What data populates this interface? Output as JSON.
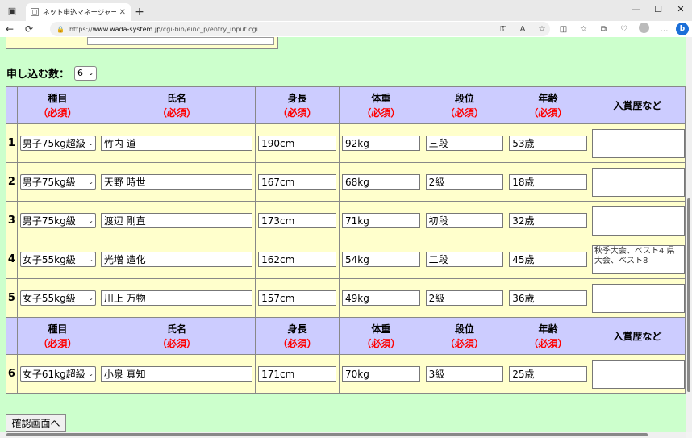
{
  "browser": {
    "tab_title": "ネット申込マネージャー 申込内容入力",
    "tab_close": "✕",
    "new_tab": "+",
    "url_prefix": "https://",
    "url_host": "www.wada-system.jp",
    "url_path": "/cgi-bin/einc_p/entry_input.cgi"
  },
  "form": {
    "count_label": "申し込む数：",
    "count_value": "6",
    "headers": [
      {
        "name": "種目",
        "req": "（必須）"
      },
      {
        "name": "氏名",
        "req": "（必須）"
      },
      {
        "name": "身長",
        "req": "（必須）"
      },
      {
        "name": "体重",
        "req": "（必須）"
      },
      {
        "name": "段位",
        "req": "（必須）"
      },
      {
        "name": "年齢",
        "req": "（必須）"
      },
      {
        "name": "入賞歴など",
        "req": ""
      }
    ],
    "rows": [
      {
        "num": "1",
        "category": "男子75kg超級",
        "name": "竹内 道",
        "height": "190cm",
        "weight": "92kg",
        "rank": "三段",
        "age": "53歳",
        "awards": ""
      },
      {
        "num": "2",
        "category": "男子75kg級",
        "name": "天野 時世",
        "height": "167cm",
        "weight": "68kg",
        "rank": "2級",
        "age": "18歳",
        "awards": ""
      },
      {
        "num": "3",
        "category": "男子75kg級",
        "name": "渡辺 剛直",
        "height": "173cm",
        "weight": "71kg",
        "rank": "初段",
        "age": "32歳",
        "awards": ""
      },
      {
        "num": "4",
        "category": "女子55kg級",
        "name": "光増 造化",
        "height": "162cm",
        "weight": "54kg",
        "rank": "二段",
        "age": "45歳",
        "awards": "秋季大会、ベスト4 県大会、ベスト8"
      },
      {
        "num": "5",
        "category": "女子55kg級",
        "name": "川上 万物",
        "height": "157cm",
        "weight": "49kg",
        "rank": "2級",
        "age": "36歳",
        "awards": ""
      },
      {
        "num": "6",
        "category": "女子61kg超級",
        "name": "小泉 真知",
        "height": "171cm",
        "weight": "70kg",
        "rank": "3級",
        "age": "25歳",
        "awards": ""
      }
    ],
    "confirm_label": "確認画面へ"
  }
}
